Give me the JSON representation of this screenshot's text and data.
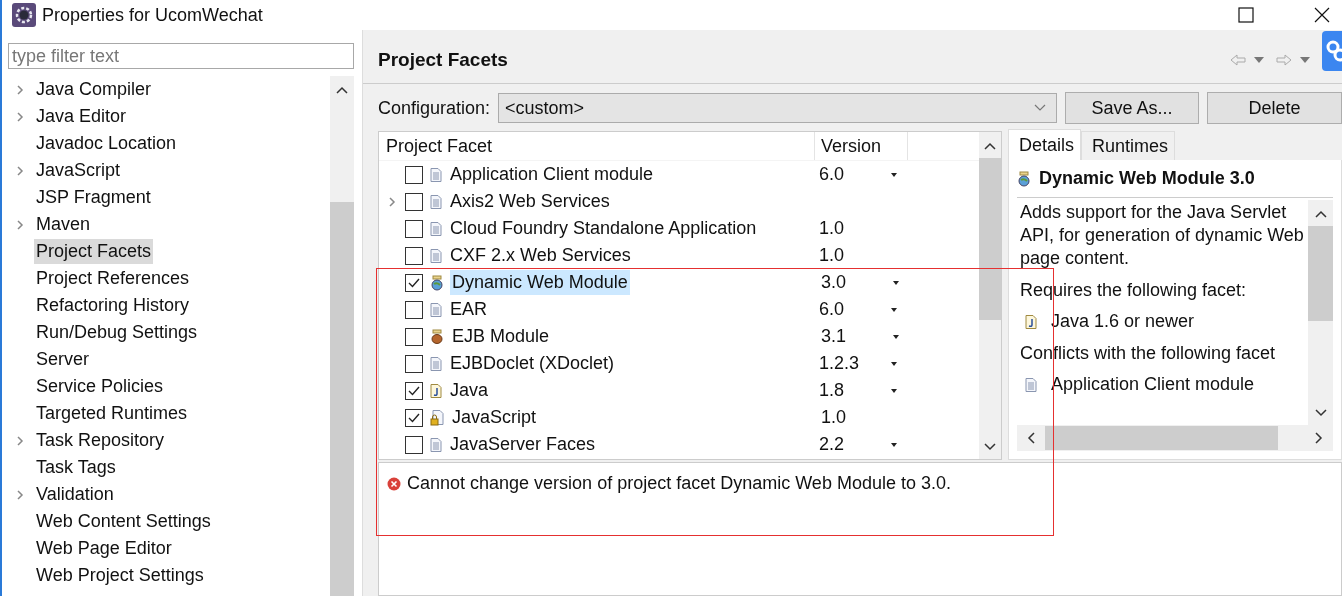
{
  "window": {
    "title": "Properties for UcomWechat"
  },
  "sidebar": {
    "filter": {
      "placeholder": "type filter text"
    },
    "items": [
      {
        "label": "Java Compiler",
        "expandable": true,
        "selected": false
      },
      {
        "label": "Java Editor",
        "expandable": true,
        "selected": false
      },
      {
        "label": "Javadoc Location",
        "expandable": false,
        "selected": false
      },
      {
        "label": "JavaScript",
        "expandable": true,
        "selected": false
      },
      {
        "label": "JSP Fragment",
        "expandable": false,
        "selected": false
      },
      {
        "label": "Maven",
        "expandable": true,
        "selected": false
      },
      {
        "label": "Project Facets",
        "expandable": false,
        "selected": true
      },
      {
        "label": "Project References",
        "expandable": false,
        "selected": false
      },
      {
        "label": "Refactoring History",
        "expandable": false,
        "selected": false
      },
      {
        "label": "Run/Debug Settings",
        "expandable": false,
        "selected": false
      },
      {
        "label": "Server",
        "expandable": false,
        "selected": false
      },
      {
        "label": "Service Policies",
        "expandable": false,
        "selected": false
      },
      {
        "label": "Targeted Runtimes",
        "expandable": false,
        "selected": false
      },
      {
        "label": "Task Repository",
        "expandable": true,
        "selected": false
      },
      {
        "label": "Task Tags",
        "expandable": false,
        "selected": false
      },
      {
        "label": "Validation",
        "expandable": true,
        "selected": false
      },
      {
        "label": "Web Content Settings",
        "expandable": false,
        "selected": false
      },
      {
        "label": "Web Page Editor",
        "expandable": false,
        "selected": false
      },
      {
        "label": "Web Project Settings",
        "expandable": false,
        "selected": false
      }
    ]
  },
  "page": {
    "title": "Project Facets",
    "configuration": {
      "label": "Configuration:",
      "value": "<custom>",
      "buttons": [
        "Save As...",
        "Delete"
      ]
    },
    "table": {
      "columns": [
        "Project Facet",
        "Version"
      ],
      "rows": [
        {
          "label": "Application Client module",
          "kind": "doc",
          "checked": false,
          "expandable": false,
          "selected": false,
          "version": "6.0",
          "dropdown": true
        },
        {
          "label": "Axis2 Web Services",
          "kind": "doc",
          "checked": false,
          "expandable": true,
          "selected": false,
          "dropdown": false
        },
        {
          "label": "Cloud Foundry Standalone Application",
          "kind": "doc",
          "checked": false,
          "expandable": false,
          "selected": false,
          "version": "1.0",
          "dropdown": false
        },
        {
          "label": "CXF 2.x Web Services",
          "kind": "doc",
          "checked": false,
          "expandable": false,
          "selected": false,
          "version": "1.0",
          "dropdown": false
        },
        {
          "label": "Dynamic Web Module",
          "kind": "globe",
          "checked": true,
          "expandable": false,
          "selected": true,
          "version": "3.0",
          "dropdown": true
        },
        {
          "label": "EAR",
          "kind": "doc",
          "checked": false,
          "expandable": false,
          "selected": false,
          "version": "6.0",
          "dropdown": true
        },
        {
          "label": "EJB Module",
          "kind": "bean",
          "checked": false,
          "expandable": false,
          "selected": false,
          "version": "3.1",
          "dropdown": true
        },
        {
          "label": "EJBDoclet (XDoclet)",
          "kind": "doc",
          "checked": false,
          "expandable": false,
          "selected": false,
          "version": "1.2.3",
          "dropdown": true
        },
        {
          "label": "Java",
          "kind": "java",
          "checked": true,
          "expandable": false,
          "selected": false,
          "version": "1.8",
          "dropdown": true
        },
        {
          "label": "JavaScript",
          "kind": "script",
          "checked": true,
          "expandable": false,
          "selected": false,
          "version": "1.0",
          "dropdown": false
        },
        {
          "label": "JavaServer Faces",
          "kind": "doc",
          "checked": false,
          "expandable": false,
          "selected": false,
          "version": "2.2",
          "dropdown": true
        }
      ]
    },
    "details": {
      "tabs": [
        {
          "label": "Details",
          "selected": true
        },
        {
          "label": "Runtimes",
          "selected": false
        }
      ],
      "title": "Dynamic Web Module 3.0",
      "blocks": [
        {
          "kind": "text",
          "text": "Adds support for the Java Servlet API, for generation of dynamic Web page content."
        },
        {
          "kind": "text",
          "text": "Requires the following facet:"
        },
        {
          "kind": "java",
          "text": "Java 1.6 or newer"
        },
        {
          "kind": "text",
          "text": "Conflicts with the following facet"
        },
        {
          "kind": "doc",
          "text": "Application Client module"
        }
      ]
    },
    "message": {
      "kind": "error",
      "text": "Cannot change version of project facet Dynamic Web Module to 3.0."
    }
  },
  "highlight": {
    "kind": "rectangle"
  }
}
